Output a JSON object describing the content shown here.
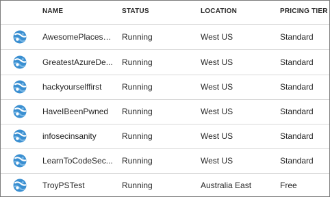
{
  "columns": {
    "name": "NAME",
    "status": "STATUS",
    "location": "LOCATION",
    "pricing_tier": "PRICING TIER"
  },
  "rows": [
    {
      "name": "AwesomePlacesNG",
      "status": "Running",
      "location": "West US",
      "pricing_tier": "Standard"
    },
    {
      "name": "GreatestAzureDe...",
      "status": "Running",
      "location": "West US",
      "pricing_tier": "Standard"
    },
    {
      "name": "hackyourselffirst",
      "status": "Running",
      "location": "West US",
      "pricing_tier": "Standard"
    },
    {
      "name": "HaveIBeenPwned",
      "status": "Running",
      "location": "West US",
      "pricing_tier": "Standard"
    },
    {
      "name": "infosecinsanity",
      "status": "Running",
      "location": "West US",
      "pricing_tier": "Standard"
    },
    {
      "name": "LearnToCodeSec...",
      "status": "Running",
      "location": "West US",
      "pricing_tier": "Standard"
    },
    {
      "name": "TroyPSTest",
      "status": "Running",
      "location": "Australia East",
      "pricing_tier": "Free"
    }
  ],
  "icon": "website-globe-icon",
  "colors": {
    "icon_blue": "#3a8fd1",
    "icon_light": "#7ab8e6",
    "divider": "#d9d9d9",
    "frame_border": "#7a7a7a"
  }
}
